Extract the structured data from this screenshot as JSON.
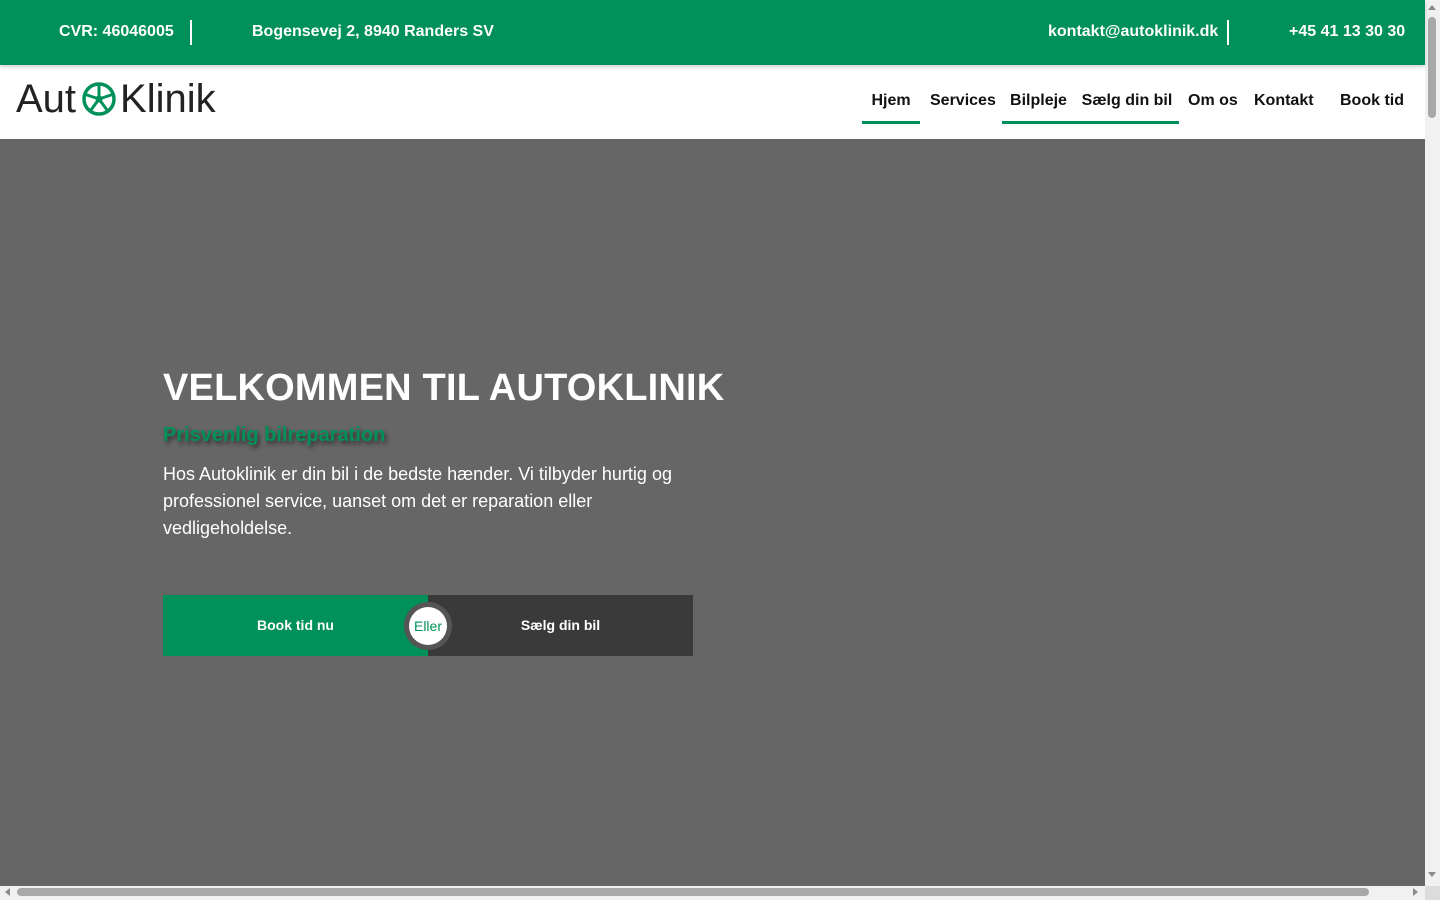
{
  "topbar": {
    "cvr": "CVR: 46046005",
    "address": "Bogensevej 2, 8940 Randers SV",
    "email": "kontakt@autoklinik.dk",
    "phone": "+45 41 13 30 30"
  },
  "logo": {
    "part1": "Aut",
    "part2": "Klinik",
    "icon": "wheel-icon"
  },
  "nav": {
    "items": [
      {
        "label": "Hjem",
        "active": true
      },
      {
        "label": "Services",
        "active": false
      },
      {
        "label": "Bilpleje",
        "active": true
      },
      {
        "label": "Sælg din bil",
        "active": true
      },
      {
        "label": "Om os",
        "active": false
      },
      {
        "label": "Kontakt",
        "active": false
      },
      {
        "label": "Book tid",
        "active": false
      }
    ]
  },
  "hero": {
    "title": "VELKOMMEN TIL AUTOKLINIK",
    "subtitle": "Prisvenlig bilreparation",
    "description": "Hos Autoklinik er din bil i de bedste hænder. Vi tilbyder hurtig og professionel service, uanset om det er reparation eller vedligeholdelse.",
    "cta_primary": "Book tid nu",
    "cta_or": "Eller",
    "cta_secondary": "Sælg din bil"
  },
  "colors": {
    "brand_green": "#00905a",
    "hero_bg": "#666666",
    "dark_button": "#3a3a3a"
  }
}
